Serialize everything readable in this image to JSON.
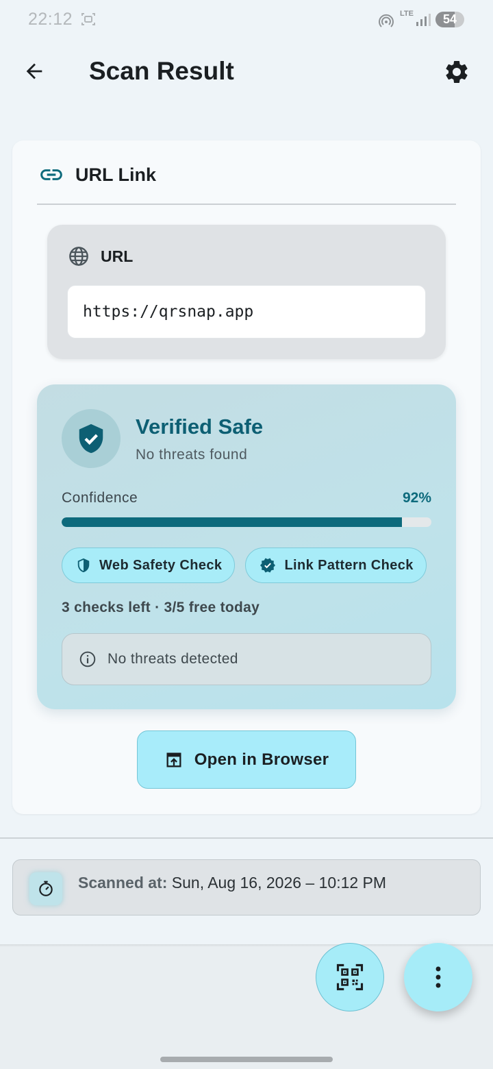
{
  "status_bar": {
    "time": "22:12",
    "network": "LTE",
    "battery": "54",
    "icons": [
      "screenshot-icon",
      "hotspot-icon",
      "signal-icon"
    ]
  },
  "app_bar": {
    "title": "Scan Result",
    "icons": [
      "back-arrow-icon",
      "gear-icon"
    ]
  },
  "result": {
    "type_label": "URL Link",
    "url_label": "URL",
    "url_value": "https://qrsnap.app",
    "safety": {
      "verdict": "Verified Safe",
      "subtitle": "No threats found",
      "confidence_label": "Confidence",
      "confidence_value": "92%",
      "confidence_fraction": 0.92,
      "chips": [
        {
          "label": "Web Safety Check",
          "icon": "shield-icon"
        },
        {
          "label": "Link Pattern Check",
          "icon": "verified-badge-icon"
        }
      ],
      "checks_left": "3 checks left · 3/5 free today",
      "threat_message": "No threats detected"
    },
    "open_button_label": "Open in Browser"
  },
  "scan_info": {
    "label": "Scanned at:",
    "value": "Sun, Aug 16, 2026 – 10:12 PM"
  },
  "colors": {
    "accent": "#0d6a7c",
    "chip_bg": "#a8ecf8",
    "fab_bg": "#a6ecf8"
  }
}
